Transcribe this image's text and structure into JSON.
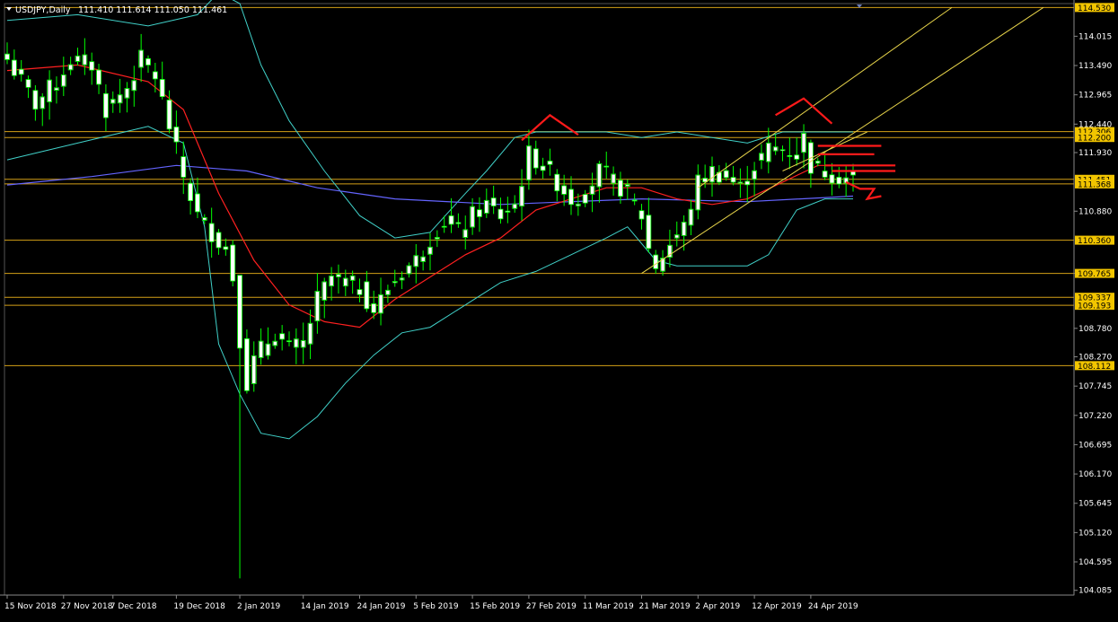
{
  "header": {
    "symbol": "USDJPY,Daily",
    "ohlc": "111.410 111.614 111.050 111.461"
  },
  "colors": {
    "background": "#000000",
    "bull": "#ffffff",
    "bear": "#ffffff",
    "wick": "#00ff00",
    "bollinger": "#40d0c8",
    "ma_red": "#ff2020",
    "ma_blue": "#6464ff",
    "level": "#d4a017",
    "channel": "#e6d34a",
    "annotation": "#ff1a1a",
    "tag_bg": "#f2c500"
  },
  "chart_data": {
    "type": "candlestick",
    "title": "USDJPY,Daily",
    "ylim": [
      104.0,
      114.6
    ],
    "y_ticks": [
      114.015,
      113.49,
      112.965,
      112.44,
      111.93,
      110.88,
      109.765,
      108.78,
      108.27,
      107.745,
      107.22,
      106.695,
      106.17,
      105.645,
      105.12,
      104.595,
      104.085
    ],
    "x_tick_labels": [
      "15 Nov 2018",
      "27 Nov 2018",
      "7 Dec 2018",
      "19 Dec 2018",
      "2 Jan 2019",
      "14 Jan 2019",
      "24 Jan 2019",
      "5 Feb 2019",
      "15 Feb 2019",
      "27 Feb 2019",
      "11 Mar 2019",
      "21 Mar 2019",
      "2 Apr 2019",
      "12 Apr 2019",
      "24 Apr 2019"
    ],
    "x_tick_index": [
      0,
      8,
      15,
      24,
      33,
      42,
      50,
      58,
      66,
      74,
      82,
      90,
      98,
      106,
      114
    ],
    "candles_count": 121,
    "close_path": [
      [
        0,
        113.6
      ],
      [
        2,
        113.2
      ],
      [
        4,
        112.8
      ],
      [
        7,
        113.2
      ],
      [
        9,
        113.6
      ],
      [
        12,
        113.5
      ],
      [
        14,
        112.7
      ],
      [
        17,
        113.1
      ],
      [
        19,
        113.6
      ],
      [
        21,
        113.3
      ],
      [
        23,
        112.4
      ],
      [
        25,
        111.5
      ],
      [
        27,
        110.8
      ],
      [
        29,
        110.5
      ],
      [
        31,
        110.2
      ],
      [
        32,
        109.7
      ],
      [
        33,
        108.6
      ],
      [
        34,
        107.8
      ],
      [
        35,
        108.2
      ],
      [
        36,
        108.4
      ],
      [
        38,
        108.7
      ],
      [
        40,
        108.4
      ],
      [
        42,
        108.5
      ],
      [
        44,
        109.3
      ],
      [
        46,
        109.7
      ],
      [
        48,
        109.6
      ],
      [
        50,
        109.5
      ],
      [
        52,
        109.1
      ],
      [
        54,
        109.5
      ],
      [
        56,
        109.8
      ],
      [
        58,
        110.0
      ],
      [
        60,
        110.4
      ],
      [
        62,
        110.7
      ],
      [
        64,
        110.5
      ],
      [
        66,
        110.8
      ],
      [
        68,
        111.0
      ],
      [
        70,
        110.8
      ],
      [
        72,
        111.0
      ],
      [
        74,
        111.9
      ],
      [
        76,
        111.7
      ],
      [
        78,
        111.4
      ],
      [
        80,
        111.1
      ],
      [
        82,
        111.2
      ],
      [
        84,
        111.6
      ],
      [
        86,
        111.4
      ],
      [
        88,
        111.2
      ],
      [
        90,
        110.8
      ],
      [
        91,
        110.2
      ],
      [
        92,
        109.9
      ],
      [
        94,
        110.3
      ],
      [
        96,
        110.6
      ],
      [
        98,
        111.4
      ],
      [
        100,
        111.6
      ],
      [
        102,
        111.5
      ],
      [
        104,
        111.3
      ],
      [
        106,
        111.7
      ],
      [
        108,
        112.0
      ],
      [
        110,
        112.0
      ],
      [
        112,
        111.9
      ],
      [
        113,
        112.2
      ],
      [
        114,
        111.7
      ],
      [
        116,
        111.6
      ],
      [
        118,
        111.5
      ],
      [
        120,
        111.46
      ]
    ],
    "indicators": {
      "ma_red_path": [
        [
          0,
          113.4
        ],
        [
          10,
          113.5
        ],
        [
          20,
          113.2
        ],
        [
          25,
          112.7
        ],
        [
          30,
          111.2
        ],
        [
          35,
          110.0
        ],
        [
          40,
          109.2
        ],
        [
          45,
          108.9
        ],
        [
          50,
          108.8
        ],
        [
          55,
          109.3
        ],
        [
          60,
          109.7
        ],
        [
          65,
          110.1
        ],
        [
          70,
          110.4
        ],
        [
          75,
          110.9
        ],
        [
          80,
          111.1
        ],
        [
          85,
          111.3
        ],
        [
          90,
          111.3
        ],
        [
          95,
          111.1
        ],
        [
          100,
          111.0
        ],
        [
          105,
          111.1
        ],
        [
          110,
          111.4
        ],
        [
          115,
          111.7
        ],
        [
          120,
          111.7
        ]
      ],
      "ma_blue_path": [
        [
          0,
          111.35
        ],
        [
          12,
          111.5
        ],
        [
          24,
          111.7
        ],
        [
          34,
          111.6
        ],
        [
          44,
          111.3
        ],
        [
          55,
          111.1
        ],
        [
          70,
          111.0
        ],
        [
          90,
          111.1
        ],
        [
          105,
          111.05
        ],
        [
          120,
          111.15
        ]
      ],
      "bb_upper_path": [
        [
          0,
          114.3
        ],
        [
          10,
          114.4
        ],
        [
          20,
          114.2
        ],
        [
          27,
          114.4
        ],
        [
          30,
          114.8
        ],
        [
          33,
          114.6
        ],
        [
          36,
          113.5
        ],
        [
          40,
          112.5
        ],
        [
          45,
          111.6
        ],
        [
          50,
          110.8
        ],
        [
          55,
          110.4
        ],
        [
          60,
          110.5
        ],
        [
          65,
          111.2
        ],
        [
          68,
          111.6
        ],
        [
          72,
          112.2
        ],
        [
          75,
          112.3
        ],
        [
          80,
          112.3
        ],
        [
          85,
          112.3
        ],
        [
          90,
          112.2
        ],
        [
          95,
          112.3
        ],
        [
          100,
          112.2
        ],
        [
          105,
          112.1
        ],
        [
          110,
          112.3
        ],
        [
          115,
          112.3
        ],
        [
          120,
          112.3
        ]
      ],
      "bb_lower_path": [
        [
          0,
          111.8
        ],
        [
          10,
          112.1
        ],
        [
          20,
          112.4
        ],
        [
          25,
          112.1
        ],
        [
          28,
          110.6
        ],
        [
          30,
          108.5
        ],
        [
          33,
          107.6
        ],
        [
          36,
          106.9
        ],
        [
          40,
          106.8
        ],
        [
          44,
          107.2
        ],
        [
          48,
          107.8
        ],
        [
          52,
          108.3
        ],
        [
          56,
          108.7
        ],
        [
          60,
          108.8
        ],
        [
          65,
          109.2
        ],
        [
          70,
          109.6
        ],
        [
          75,
          109.8
        ],
        [
          80,
          110.1
        ],
        [
          85,
          110.4
        ],
        [
          88,
          110.6
        ],
        [
          92,
          110.0
        ],
        [
          95,
          109.9
        ],
        [
          100,
          109.9
        ],
        [
          105,
          109.9
        ],
        [
          108,
          110.1
        ],
        [
          112,
          110.9
        ],
        [
          116,
          111.1
        ],
        [
          120,
          111.1
        ]
      ]
    },
    "levels": [
      {
        "label": "114.530",
        "value": 114.53
      },
      {
        "label": "112.306",
        "value": 112.306
      },
      {
        "label": "112.200",
        "value": 112.2
      },
      {
        "label": "111.451",
        "value": 111.451
      },
      {
        "label": "111.368",
        "value": 111.368
      },
      {
        "label": "110.360",
        "value": 110.36
      },
      {
        "label": "109.765",
        "value": 109.765
      },
      {
        "label": "109.337",
        "value": 109.337
      },
      {
        "label": "109.193",
        "value": 109.193
      },
      {
        "label": "108.112",
        "value": 108.112
      }
    ],
    "channel_lines": [
      {
        "from": [
          90,
          109.765
        ],
        "to": [
          147,
          114.53
        ]
      },
      {
        "from": [
          98,
          111.3
        ],
        "to": [
          134,
          114.53
        ]
      },
      {
        "from": [
          110,
          111.6
        ],
        "to": [
          122,
          112.3
        ]
      }
    ],
    "annotations": {
      "peak_left": [
        [
          73,
          112.15
        ],
        [
          77,
          112.6
        ],
        [
          81,
          112.25
        ]
      ],
      "peak_right": [
        [
          109,
          112.6
        ],
        [
          113,
          112.9
        ],
        [
          117,
          112.45
        ]
      ],
      "resistance_marks": [
        [
          115,
          112.05
        ],
        [
          124,
          112.05
        ],
        [
          115,
          111.9
        ],
        [
          123,
          111.9
        ],
        [
          116,
          111.7
        ],
        [
          126,
          111.7
        ],
        [
          117,
          111.6
        ],
        [
          126,
          111.6
        ]
      ],
      "arrow_down": [
        [
          119,
          111.4
        ],
        [
          121,
          111.28
        ],
        [
          123,
          111.28
        ],
        [
          122,
          111.1
        ],
        [
          124,
          111.15
        ]
      ]
    }
  }
}
